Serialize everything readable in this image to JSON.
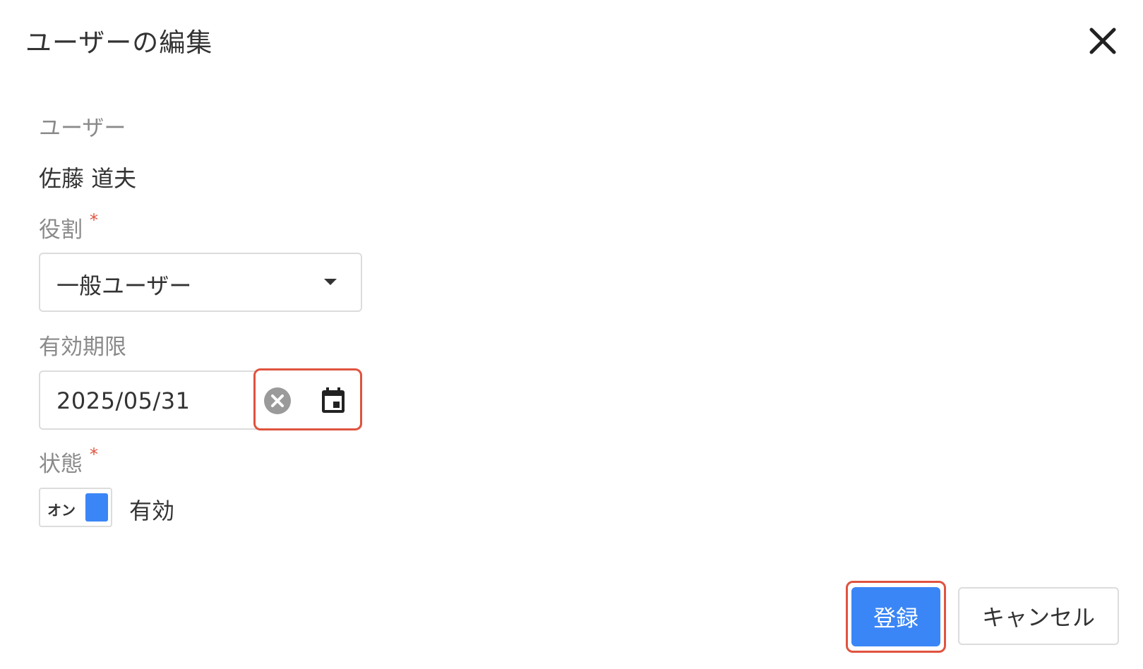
{
  "dialog": {
    "title": "ユーザーの編集",
    "close_icon": "close-icon"
  },
  "form": {
    "user": {
      "label": "ユーザー",
      "value": "佐藤 道夫"
    },
    "role": {
      "label": "役割",
      "required_mark": "*",
      "selected": "一般ユーザー",
      "icon": "chevron-down-icon"
    },
    "expiry": {
      "label": "有効期限",
      "value": "2025/05/31",
      "clear_icon": "clear-icon",
      "calendar_icon": "calendar-icon"
    },
    "status": {
      "label": "状態",
      "required_mark": "*",
      "toggle_text": "オン",
      "toggle_on": true,
      "value_label": "有効"
    }
  },
  "actions": {
    "submit_label": "登録",
    "cancel_label": "キャンセル"
  },
  "colors": {
    "accent": "#3b86f6",
    "highlight": "#e0533f",
    "border": "#dcdcdc",
    "label": "#8a8a8a",
    "text": "#333333"
  }
}
